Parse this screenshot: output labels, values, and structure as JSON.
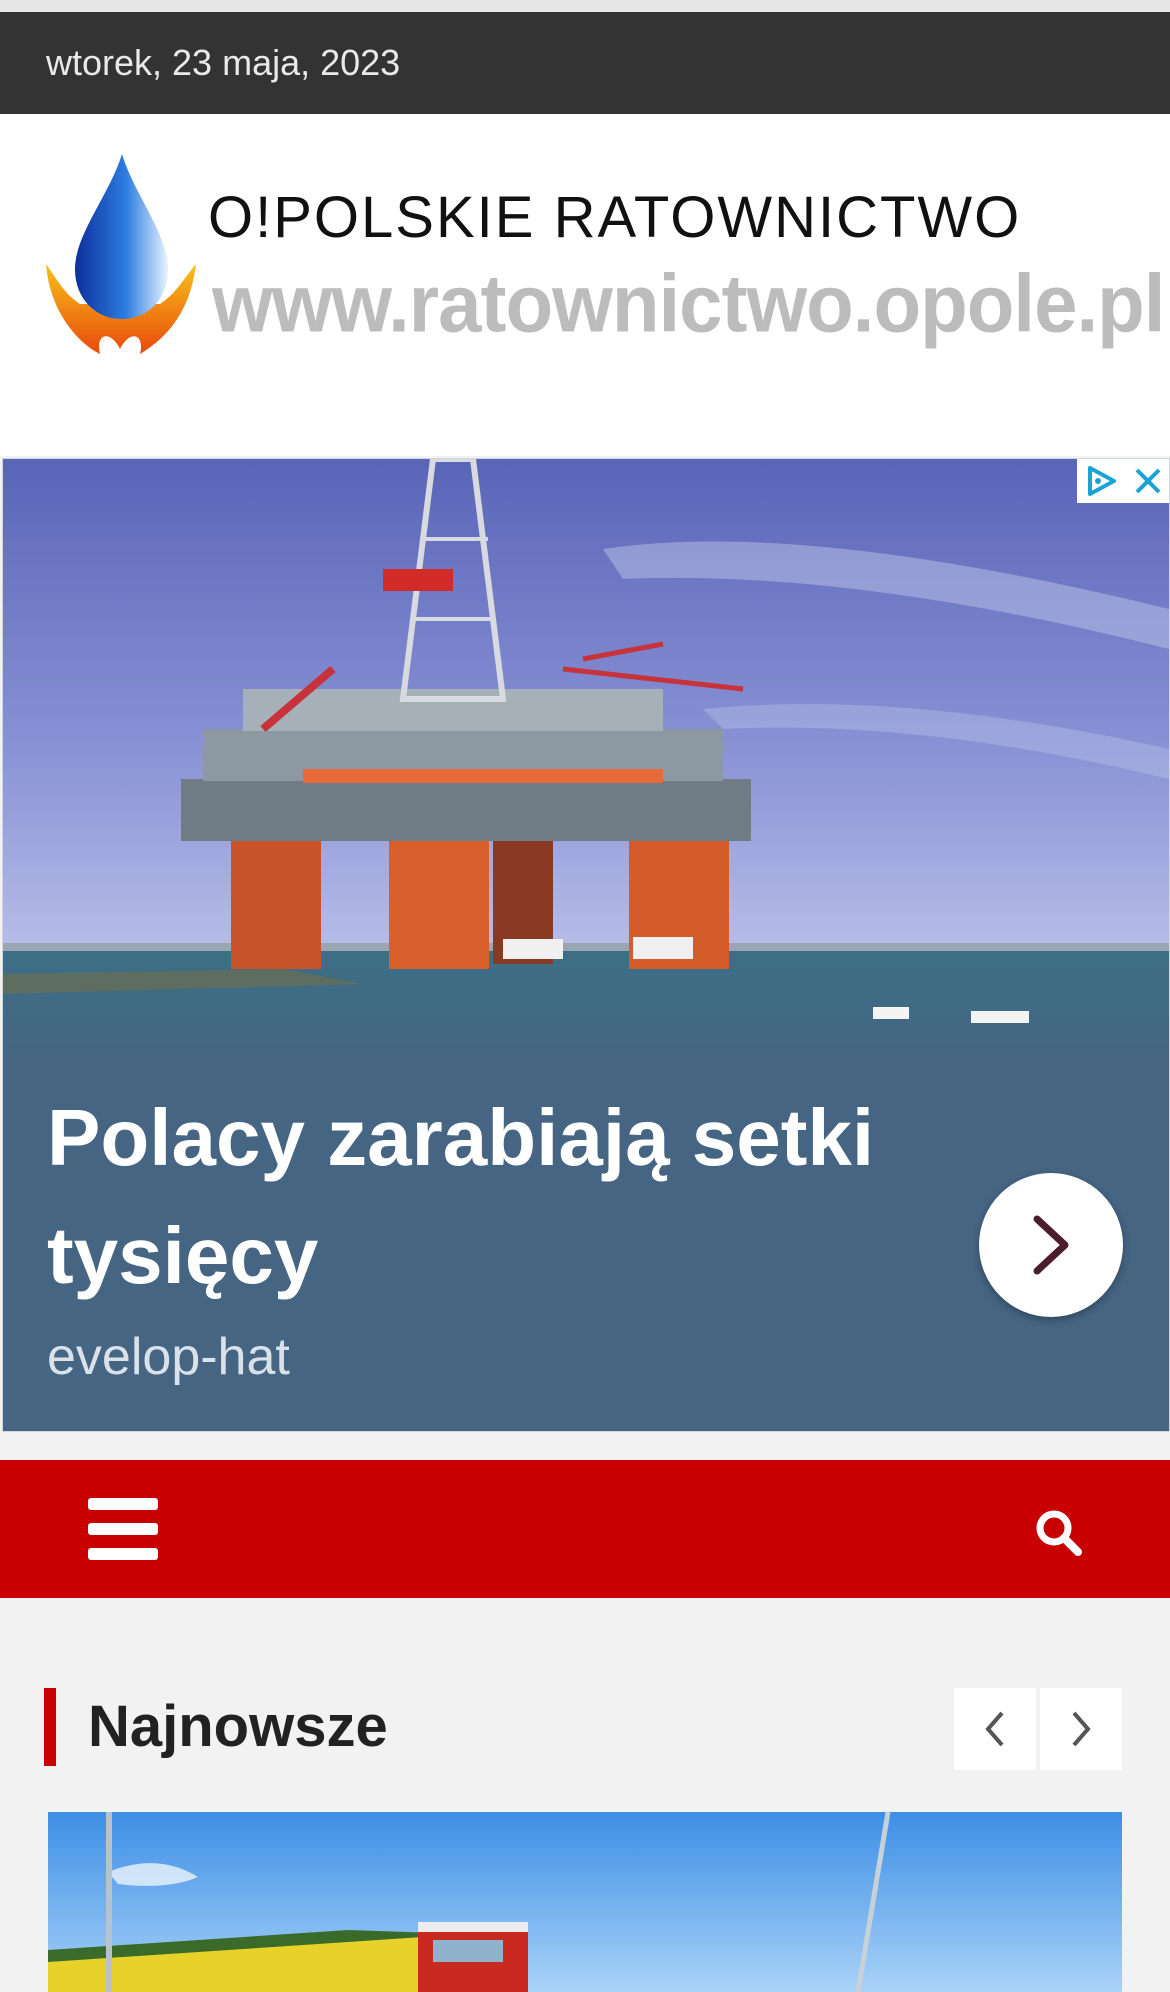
{
  "topbar": {
    "date": "wtorek, 23 maja, 2023"
  },
  "header": {
    "logo_title": "O!POLSKIE RATOWNICTWO",
    "logo_url": "www.ratownictwo.opole.pl"
  },
  "ad": {
    "title": "Polacy zarabiają setki tysięcy",
    "sponsor": "evelop-hat",
    "icons": [
      "adchoices-icon",
      "close-icon",
      "chevron-right-icon"
    ]
  },
  "navbar": {
    "icons": [
      "hamburger-menu-icon",
      "search-icon"
    ],
    "background": "#c80000"
  },
  "section": {
    "title": "Najnowsze",
    "accent": "#c80000"
  }
}
